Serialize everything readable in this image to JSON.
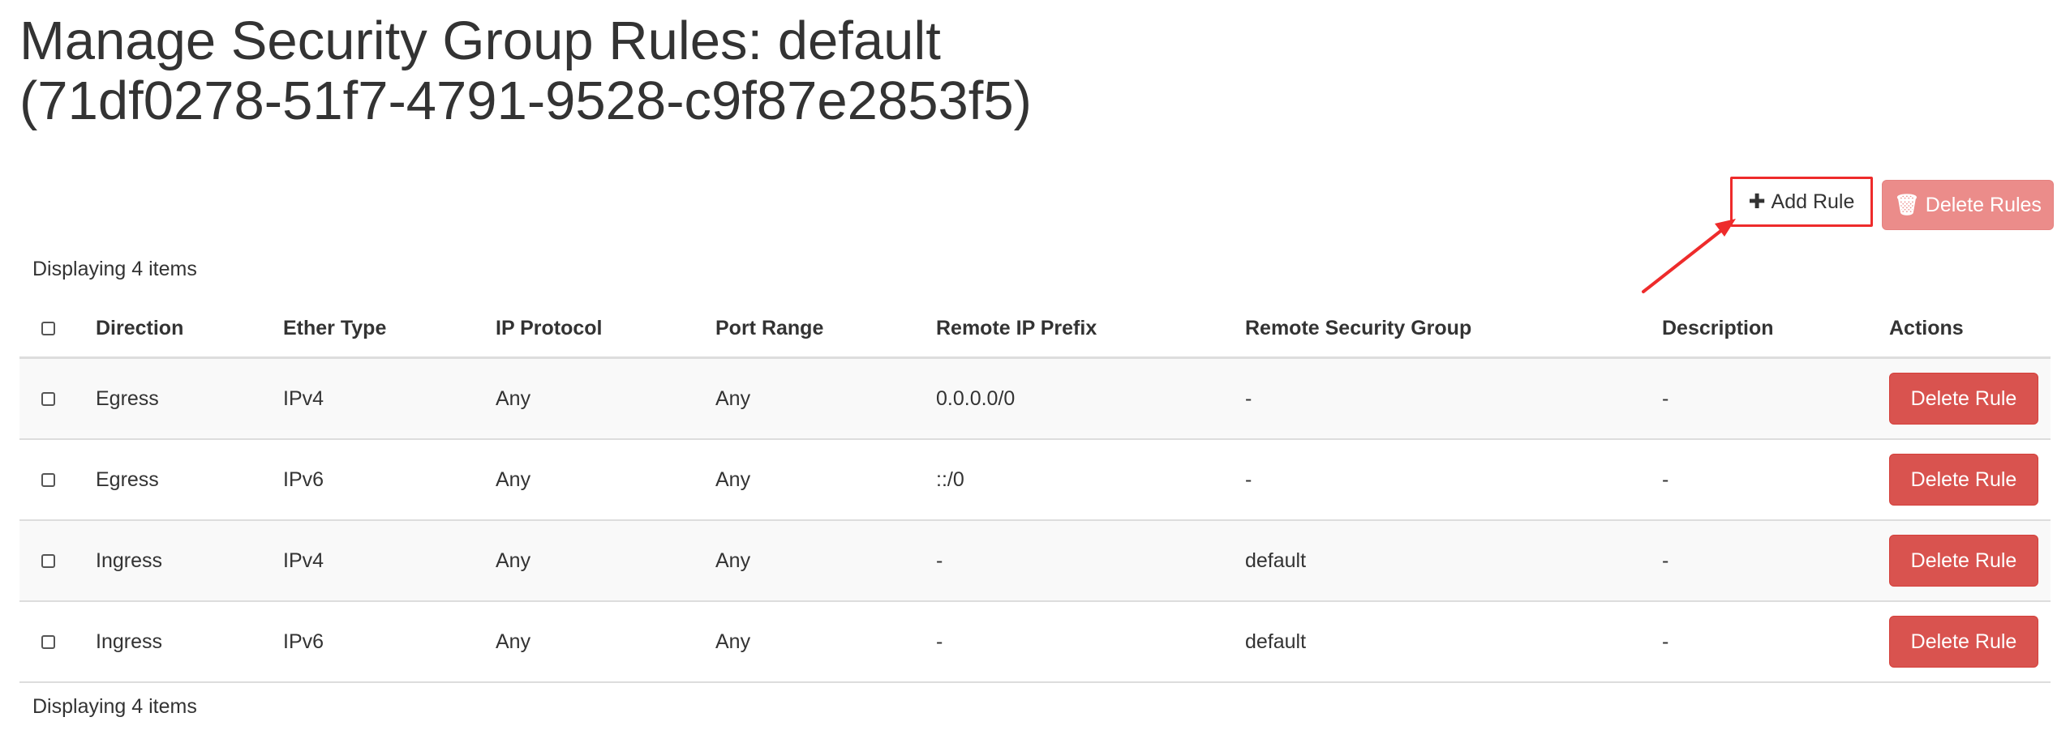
{
  "page": {
    "title_line1": "Manage Security Group Rules: default",
    "title_line2": "(71df0278-51f7-4791-9528-c9f87e2853f5)"
  },
  "toolbar": {
    "add_rule_glyph": "✚",
    "add_rule_label": "Add Rule",
    "delete_rules_glyph": "🗑",
    "delete_rules_label": "Delete Rules"
  },
  "table": {
    "count_top": "Displaying 4 items",
    "count_bottom": "Displaying 4 items",
    "headers": {
      "direction": "Direction",
      "ether_type": "Ether Type",
      "ip_protocol": "IP Protocol",
      "port_range": "Port Range",
      "remote_ip_prefix": "Remote IP Prefix",
      "remote_security_group": "Remote Security Group",
      "description": "Description",
      "actions": "Actions"
    },
    "rows": [
      {
        "direction": "Egress",
        "ether_type": "IPv4",
        "ip_protocol": "Any",
        "port_range": "Any",
        "remote_ip_prefix": "0.0.0.0/0",
        "remote_security_group": "-",
        "description": "-",
        "action_label": "Delete Rule"
      },
      {
        "direction": "Egress",
        "ether_type": "IPv6",
        "ip_protocol": "Any",
        "port_range": "Any",
        "remote_ip_prefix": "::/0",
        "remote_security_group": "-",
        "description": "-",
        "action_label": "Delete Rule"
      },
      {
        "direction": "Ingress",
        "ether_type": "IPv4",
        "ip_protocol": "Any",
        "port_range": "Any",
        "remote_ip_prefix": "-",
        "remote_security_group": "default",
        "description": "-",
        "action_label": "Delete Rule"
      },
      {
        "direction": "Ingress",
        "ether_type": "IPv6",
        "ip_protocol": "Any",
        "port_range": "Any",
        "remote_ip_prefix": "-",
        "remote_security_group": "default",
        "description": "-",
        "action_label": "Delete Rule"
      }
    ]
  },
  "colors": {
    "danger": "#d9534f",
    "danger_disabled": "#eb8c8a",
    "annotation_red": "#ee2b2b",
    "text": "#333333",
    "row_stripe": "#f9f9f9"
  },
  "icons": {
    "add_rule": "plus-icon",
    "delete_rules": "trash-icon",
    "annotation": "arrow-icon"
  }
}
